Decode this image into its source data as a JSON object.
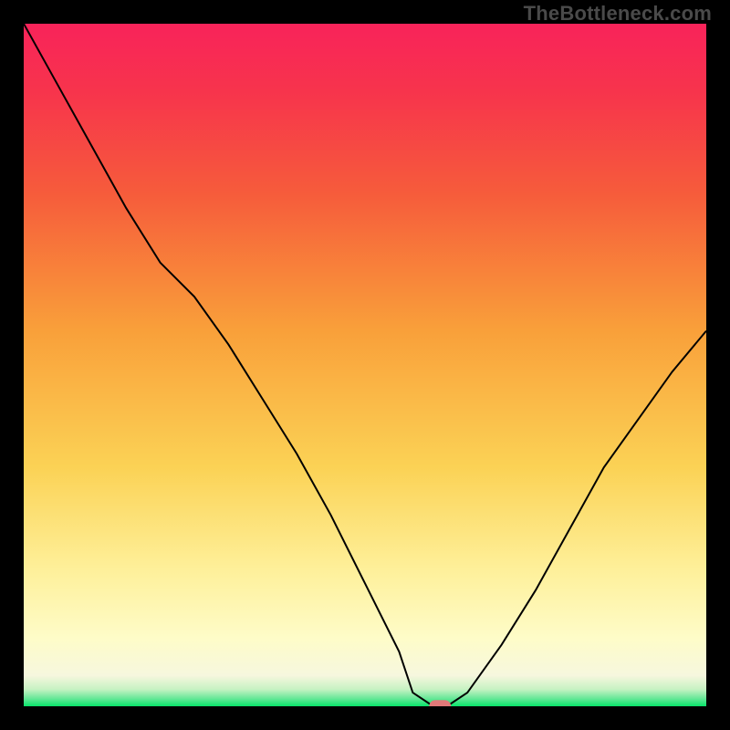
{
  "watermark": "TheBottleneck.com",
  "chart_data": {
    "type": "line",
    "title": "",
    "xlabel": "",
    "ylabel": "",
    "xlim": [
      0,
      100
    ],
    "ylim": [
      0,
      100
    ],
    "grid": false,
    "x": [
      0,
      5,
      10,
      15,
      20,
      25,
      30,
      35,
      40,
      45,
      50,
      55,
      57,
      60,
      62,
      65,
      70,
      75,
      80,
      85,
      90,
      95,
      100
    ],
    "values": [
      100,
      91,
      82,
      73,
      65,
      60,
      53,
      45,
      37,
      28,
      18,
      8,
      2,
      0,
      0,
      2,
      9,
      17,
      26,
      35,
      42,
      49,
      55
    ],
    "marker": {
      "x": 61,
      "y": 0,
      "shape": "rounded-rect",
      "color": "#e07878"
    },
    "gradient_stops": [
      {
        "offset": 0.0,
        "color": "#07e46a"
      },
      {
        "offset": 0.012,
        "color": "#6be89a"
      },
      {
        "offset": 0.025,
        "color": "#c7f2c3"
      },
      {
        "offset": 0.045,
        "color": "#f6f7de"
      },
      {
        "offset": 0.1,
        "color": "#fefcc8"
      },
      {
        "offset": 0.2,
        "color": "#fef09a"
      },
      {
        "offset": 0.35,
        "color": "#fbd255"
      },
      {
        "offset": 0.55,
        "color": "#f9a03a"
      },
      {
        "offset": 0.75,
        "color": "#f65c3b"
      },
      {
        "offset": 0.9,
        "color": "#f7344c"
      },
      {
        "offset": 1.0,
        "color": "#f8235a"
      }
    ],
    "line_color": "#000000"
  }
}
